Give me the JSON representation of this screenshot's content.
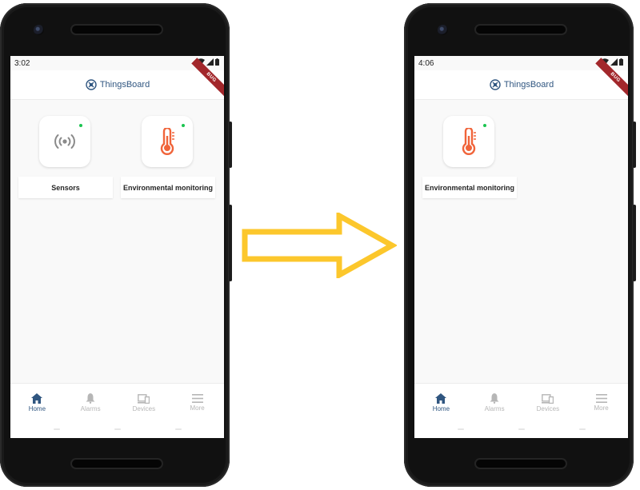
{
  "colors": {
    "brand": "#305680",
    "thermometer": "#f0643a",
    "online": "#1bc450",
    "nav_inactive": "#b6b6b6",
    "arrow": "#fcc72c"
  },
  "app": {
    "brand_name": "ThingsBoard",
    "debug_banner": "BUG"
  },
  "screens": [
    {
      "time": "3:02",
      "devices": [
        {
          "label": "Sensors",
          "icon": "sensors-icon"
        },
        {
          "label": "Environmental monitoring",
          "icon": "thermometer-icon"
        }
      ]
    },
    {
      "time": "4:06",
      "devices": [
        {
          "label": "Environmental monitoring",
          "icon": "thermometer-icon"
        }
      ]
    }
  ],
  "nav": [
    {
      "label": "Home",
      "icon": "home-icon",
      "active": true
    },
    {
      "label": "Alarms",
      "icon": "bell-icon",
      "active": false
    },
    {
      "label": "Devices",
      "icon": "devices-icon",
      "active": false
    },
    {
      "label": "More",
      "icon": "menu-icon",
      "active": false
    }
  ]
}
